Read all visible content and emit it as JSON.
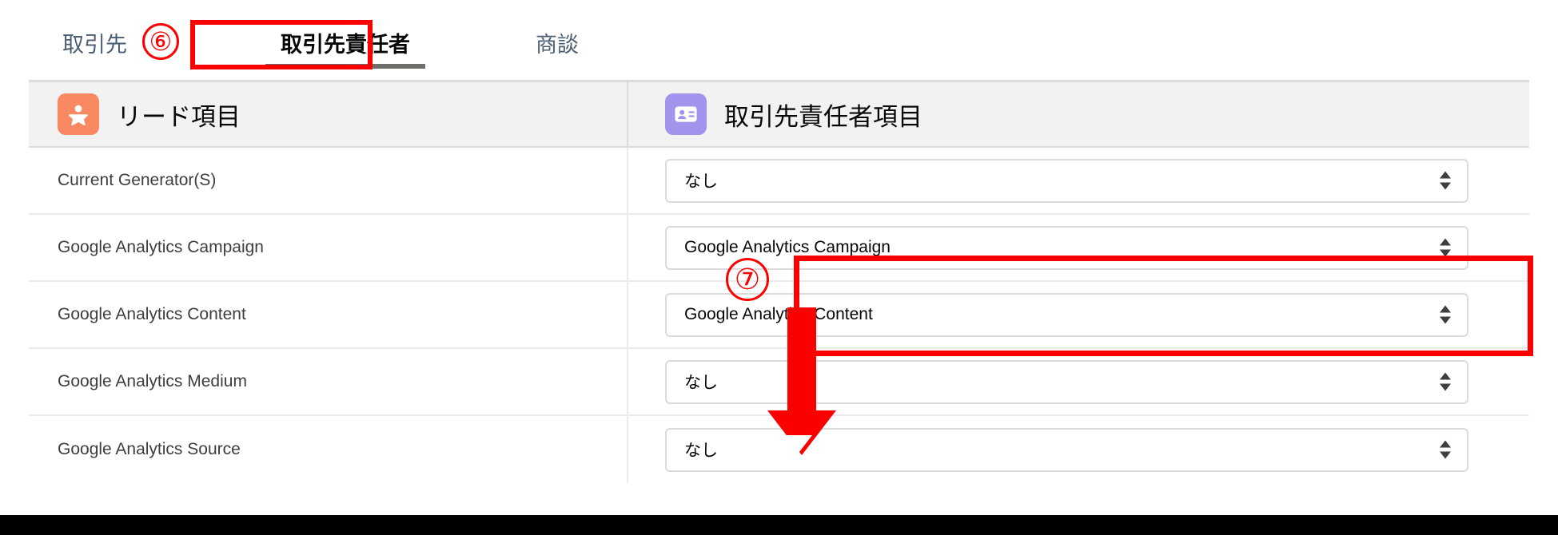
{
  "tabs": [
    {
      "label": "取引先",
      "active": false
    },
    {
      "label": "取引先責任者",
      "active": true
    },
    {
      "label": "商談",
      "active": false
    }
  ],
  "annotations": {
    "step_six": "⑥",
    "step_seven": "⑦",
    "highlight_color": "#fc0000"
  },
  "table": {
    "headers": {
      "left": {
        "title": "リード項目",
        "icon": "lead-star-icon",
        "icon_color": "#f88962"
      },
      "right": {
        "title": "取引先責任者項目",
        "icon": "contact-card-icon",
        "icon_color": "#a094ed"
      }
    },
    "rows": [
      {
        "field": "Current Generator(S)",
        "mapping": "なし",
        "highlighted": false
      },
      {
        "field": "Google Analytics Campaign",
        "mapping": "Google Analytics Campaign",
        "highlighted": true
      },
      {
        "field": "Google Analytics Content",
        "mapping": "Google Analytics Content",
        "highlighted": true
      },
      {
        "field": "Google Analytics Medium",
        "mapping": "なし",
        "highlighted": false
      },
      {
        "field": "Google Analytics Source",
        "mapping": "なし",
        "highlighted": false
      }
    ]
  }
}
